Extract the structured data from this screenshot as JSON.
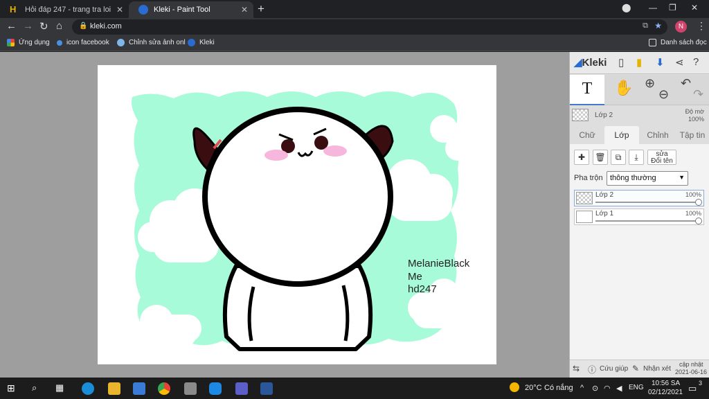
{
  "browser": {
    "tabs": [
      {
        "title": "Hỏi đáp 247 - trang tra loi",
        "active": false
      },
      {
        "title": "Kleki - Paint Tool",
        "active": true
      }
    ],
    "new_tab": "+",
    "url": "kleki.com",
    "profile_initial": "N",
    "bookmarks": [
      {
        "label": "Ứng dụng"
      },
      {
        "label": "icon facebook"
      },
      {
        "label": "Chỉnh sửa ảnh onl"
      },
      {
        "label": "Kleki"
      }
    ],
    "reading_list": "Danh sách đọc"
  },
  "kleki": {
    "logo_text": "Kleki",
    "layer_header": {
      "name": "Lớp 2",
      "opacity_label": "Độ mờ",
      "opacity_value": "100%"
    },
    "tabs": [
      {
        "label": "Chữ",
        "active": false
      },
      {
        "label": "Lớp",
        "active": true
      },
      {
        "label": "Chỉnh",
        "active": false
      },
      {
        "label": "Tập tin",
        "active": false
      }
    ],
    "rename_label": "sửa\nĐổi tên",
    "blend_label": "Pha trộn",
    "blend_value": "thông thường",
    "layers": [
      {
        "name": "Lớp 2",
        "opacity": "100%",
        "selected": true
      },
      {
        "name": "Lớp 1",
        "opacity": "100%",
        "selected": false
      }
    ],
    "footer": {
      "help": "Cứu giúp",
      "feedback": "Nhận xét",
      "update_label": "cập nhật",
      "update_date": "2021-06-16"
    }
  },
  "canvas": {
    "text_lines": [
      "MelanieBlack",
      "Me",
      "hd247"
    ],
    "colors": {
      "background_mint": "#a7fbd8",
      "ear": "#3a0d10",
      "blush": "#f7b7dc"
    }
  },
  "taskbar": {
    "weather_temp": "20°C",
    "weather_desc": "Có nắng",
    "language": "ENG",
    "time": "10:56 SA",
    "date": "02/12/2021",
    "notification_count": "3"
  }
}
